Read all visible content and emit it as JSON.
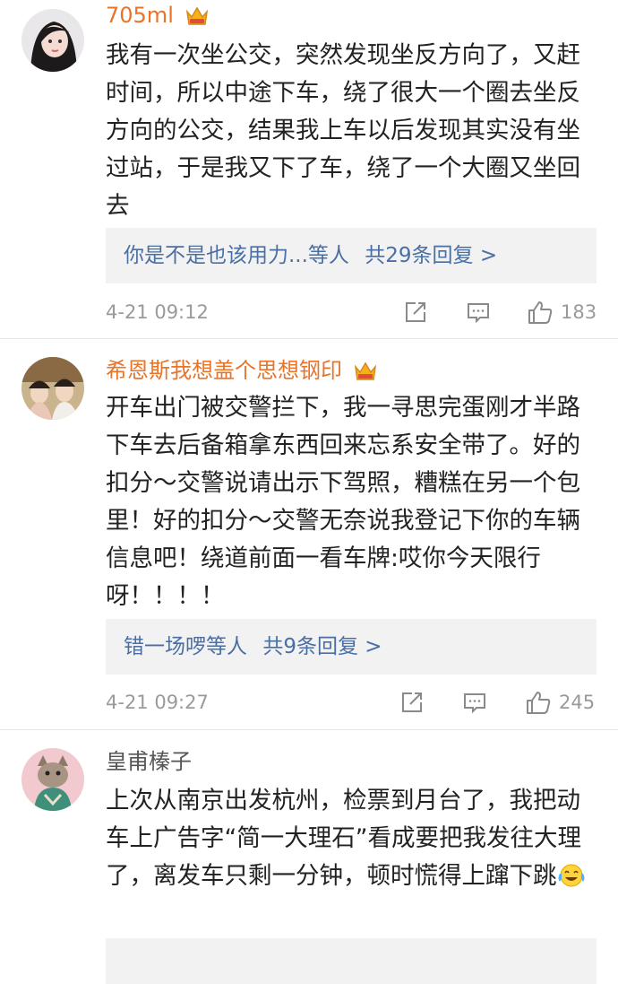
{
  "comments": [
    {
      "username": "705ml",
      "body": "我有一次坐公交，突然发现坐反方向了，又赶时间，所以中途下车，绕了很大一个圈去坐反方向的公交，结果我上车以后发现其实没有坐过站，于是我又下了车，绕了一个大圈又坐回去",
      "reply_summary": "你是不是也该用力...等人",
      "reply_count": "共29条回复 >",
      "time": "4-21 09:12",
      "likes": "183",
      "vip": true
    },
    {
      "username": "希恩斯我想盖个思想钢印",
      "body": "开车出门被交警拦下，我一寻思完蛋刚才半路下车去后备箱拿东西回来忘系安全带了。好的扣分～交警说请出示下驾照，糟糕在另一个包里！好的扣分～交警无奈说我登记下你的车辆信息吧！绕道前面一看车牌:哎你今天限行呀！！！！",
      "reply_summary": "错一场啰等人",
      "reply_count": "共9条回复 >",
      "time": "4-21 09:27",
      "likes": "245",
      "vip": true
    },
    {
      "username": "皇甫榛子",
      "body": "上次从南京出发杭州，检票到月台了，我把动车上广告字“简一大理石”看成要把我发往大理了，离发车只剩一分钟，顿时慌得上蹿下跳",
      "emoji": "laugh-cry-icon",
      "vip": false
    }
  ],
  "colors": {
    "vip_name": "#e8742a",
    "reply_link": "#4a6fa5",
    "meta_gray": "#9a9a9a",
    "reply_bg": "#f2f2f2"
  }
}
